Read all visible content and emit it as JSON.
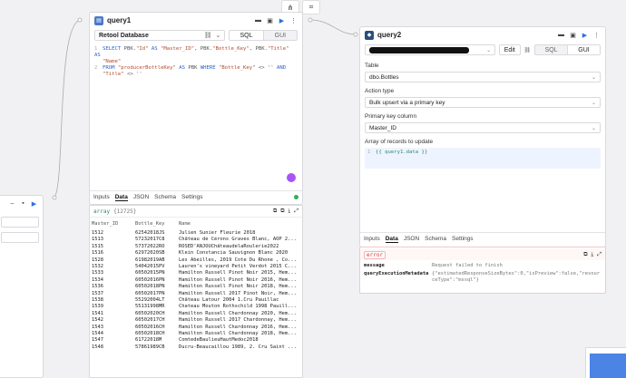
{
  "toolbar_icons": [
    "share-nodes-icon",
    "crop-icon"
  ],
  "query1": {
    "title": "query1",
    "resource": "Retool Database",
    "mode_sql": "SQL",
    "mode_gui": "GUI",
    "code_lines": [
      {
        "n": "1",
        "tokens": [
          [
            "kw",
            "SELECT "
          ],
          [
            "op",
            "PBK."
          ],
          [
            "str",
            "\"Id\""
          ],
          [
            "kw",
            " AS "
          ],
          [
            "str",
            "\"Master_ID\""
          ],
          [
            "op",
            ", PBK."
          ],
          [
            "str",
            "\"Bottle_Key\""
          ],
          [
            "op",
            ", PBK."
          ],
          [
            "str",
            "\"Title\""
          ],
          [
            "kw",
            " AS"
          ]
        ]
      },
      {
        "n": "",
        "tokens": [
          [
            "str",
            "\"Name\""
          ]
        ]
      },
      {
        "n": "2",
        "tokens": [
          [
            "kw",
            "FROM "
          ],
          [
            "str",
            "\"producerBottleKey\""
          ],
          [
            "kw",
            " AS "
          ],
          [
            "op",
            "PBK "
          ],
          [
            "kw",
            "WHERE "
          ],
          [
            "str",
            "\"Bottle_Key\""
          ],
          [
            "op",
            " <> "
          ],
          [
            "str",
            "''"
          ],
          [
            "kw",
            " AND"
          ]
        ]
      },
      {
        "n": "",
        "tokens": [
          [
            "str",
            "\"Title\""
          ],
          [
            "op",
            " <> "
          ],
          [
            "str",
            "''"
          ]
        ]
      }
    ],
    "tabs": [
      "Inputs",
      "Data",
      "JSON",
      "Schema",
      "Settings"
    ],
    "active_tab": "Data",
    "results_header": "array",
    "results_count": "{12725}",
    "columns": [
      "Master_ID",
      "Bottle_Key",
      "Name"
    ],
    "rows": [
      [
        "1512",
        "62542018JS",
        "Julien Sunier Fleurie 2018"
      ],
      [
        "1513",
        "57232017C8",
        "Château de Cérons Graves Blanc, AOP 2..."
      ],
      [
        "1515",
        "57372022RO",
        "ROSEDʼANJOUChâteaudelaRoulerie2022"
      ],
      [
        "1516",
        "62972020SB",
        "Klein Constancia Sauvignon Blanc 2020"
      ],
      [
        "1528",
        "61982019AB",
        "Les Abeilles, 2019 Cote Du Rhone , Co..."
      ],
      [
        "1532",
        "54042015PV",
        "Laurenʼs vineyard Petit Verdot 2015 C..."
      ],
      [
        "1533",
        "60502015PN",
        "Hamilton Russell Pinot Noir 2015, Hem..."
      ],
      [
        "1534",
        "60502016PN",
        "Hamilton Russell Pinot Noir 2016, Hem..."
      ],
      [
        "1536",
        "60502018PN",
        "Hamilton Russell Pinot Noir 2018, Hem..."
      ],
      [
        "1537",
        "60502017PN",
        "Hamilton Russell 2017 Pinot Noir, Hem..."
      ],
      [
        "1538",
        "55292004LT",
        "Château Latour 2004 1.Cru Pauillac"
      ],
      [
        "1539",
        "55131998MR",
        "Chateau Mouton Rothschild 1998 Pauill..."
      ],
      [
        "1541",
        "60502020CH",
        "Hamilton Russell Chardonnay 2020, Hem..."
      ],
      [
        "1542",
        "60502017CH",
        "Hamilton Russell 2017 Chardonnay, Hem..."
      ],
      [
        "1543",
        "60502016CH",
        "Hamilton Russell Chardonnay 2016, Hem..."
      ],
      [
        "1544",
        "60502018CH",
        "Hamilton Russell Chardonnay 2018, Hem..."
      ],
      [
        "1547",
        "61722018M",
        "ComtedeBaulieuHautMedoc2018"
      ],
      [
        "1548",
        "57861989CB",
        "Ducru-Beaucaillou 1989, 2. Cru Saint ..."
      ]
    ]
  },
  "query2": {
    "title": "query2",
    "edit_label": "Edit",
    "mode_sql": "SQL",
    "mode_gui": "GUI",
    "table_label": "Table",
    "table_value": "dbo.Bottles",
    "action_label": "Action type",
    "action_value": "Bulk upsert via a primary key",
    "pk_label": "Primary key column",
    "pk_value": "Master_ID",
    "array_label": "Array of records to update",
    "array_code_n": "1",
    "array_code": "{{ query1.data }}",
    "tabs": [
      "Inputs",
      "Data",
      "JSON",
      "Schema",
      "Settings"
    ],
    "active_tab": "Data",
    "error_badge": "error",
    "error_rows": [
      {
        "key": "message",
        "value": "Request failed to finish"
      },
      {
        "key": "queryExecutionMetadata",
        "value": "{\"estimatedResponseSizeBytes\":0,\"isPreview\":false,\"resourceType\":\"mssql\"}"
      }
    ]
  }
}
